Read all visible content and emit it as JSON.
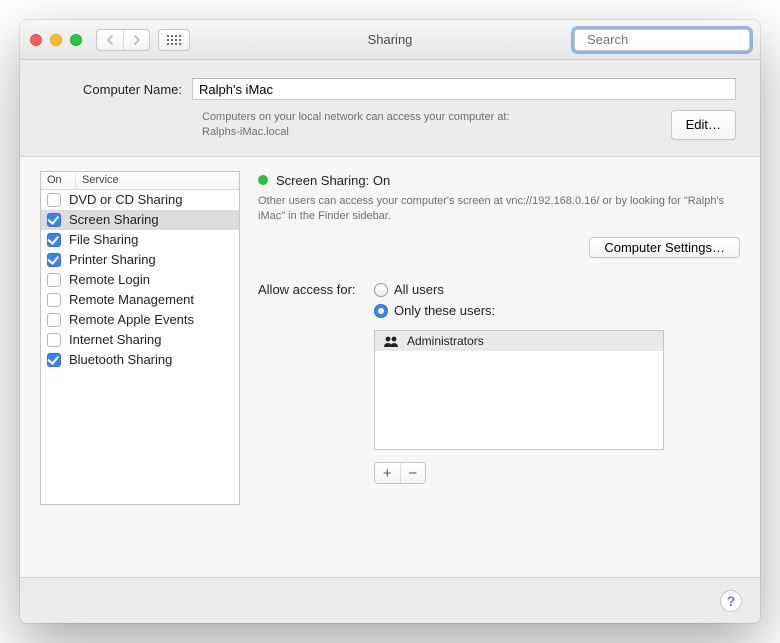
{
  "title": "Sharing",
  "search_placeholder": "Search",
  "computer_name_label": "Computer Name:",
  "computer_name_value": "Ralph's iMac",
  "local_hint_line1": "Computers on your local network can access your computer at:",
  "local_hint_line2": "Ralphs-iMac.local",
  "edit_label": "Edit…",
  "service_headers": {
    "on": "On",
    "service": "Service"
  },
  "services": [
    {
      "label": "DVD or CD Sharing",
      "on": false,
      "selected": false
    },
    {
      "label": "Screen Sharing",
      "on": true,
      "selected": true
    },
    {
      "label": "File Sharing",
      "on": true,
      "selected": false
    },
    {
      "label": "Printer Sharing",
      "on": true,
      "selected": false
    },
    {
      "label": "Remote Login",
      "on": false,
      "selected": false
    },
    {
      "label": "Remote Management",
      "on": false,
      "selected": false
    },
    {
      "label": "Remote Apple Events",
      "on": false,
      "selected": false
    },
    {
      "label": "Internet Sharing",
      "on": false,
      "selected": false
    },
    {
      "label": "Bluetooth Sharing",
      "on": true,
      "selected": false
    }
  ],
  "status": {
    "color": "#2cbf3b",
    "text": "Screen Sharing: On",
    "info": "Other users can access your computer's screen at vnc://192.168.0.16/ or by looking for \"Ralph's iMac\" in the Finder sidebar."
  },
  "computer_settings_label": "Computer Settings…",
  "access": {
    "label": "Allow access for:",
    "all_users": "All users",
    "only_these": "Only these users:",
    "selected": "only"
  },
  "users": [
    {
      "name": "Administrators"
    }
  ],
  "help": "?"
}
